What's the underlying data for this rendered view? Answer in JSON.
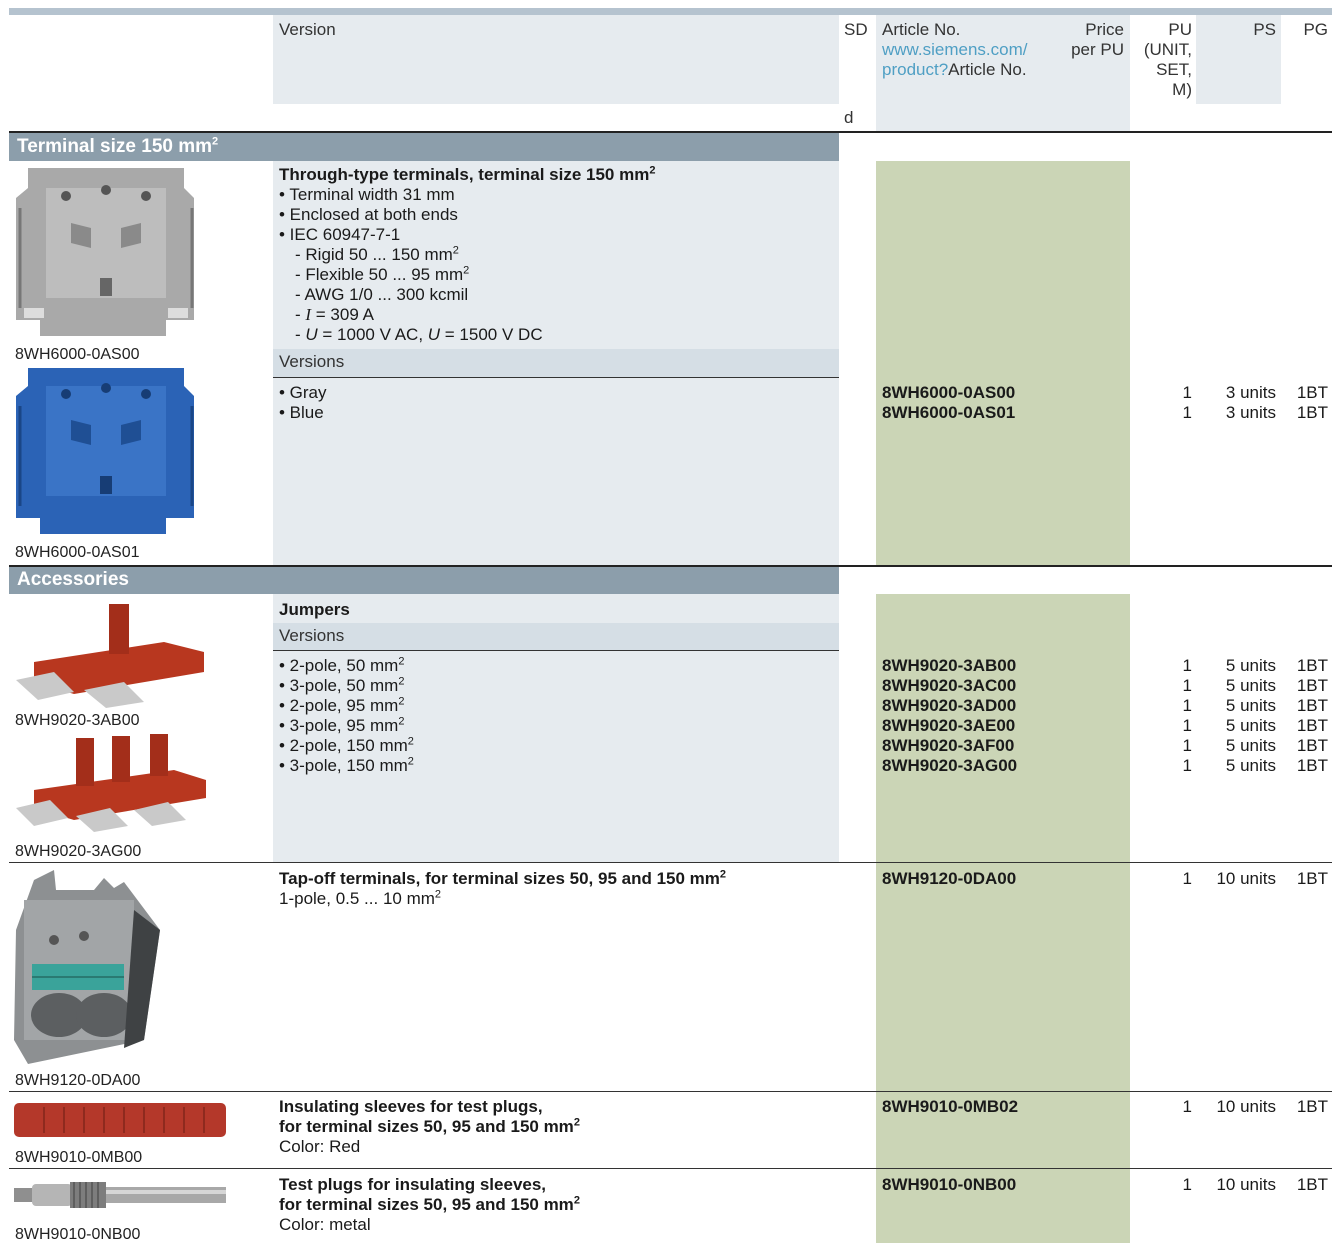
{
  "header": {
    "version": "Version",
    "sd": "SD",
    "sd_d": "d",
    "article_no": "Article No.",
    "article_link_1": "www.siemens.com/",
    "article_link_2": "product?",
    "article_link_3": "Article No.",
    "price_1": "Price",
    "price_2": "per PU",
    "pu_1": "PU",
    "pu_2": "(UNIT,",
    "pu_3": "SET,",
    "pu_4": "M)",
    "ps": "PS",
    "pg": "PG"
  },
  "section1": {
    "title": "Terminal size 150 mm",
    "title_sup": "2",
    "product": {
      "title": "Through-type terminals, terminal size 150 mm",
      "title_sup": "2",
      "bullets": [
        "• Terminal width 31 mm",
        "• Enclosed at both ends",
        "• IEC 60947-7-1"
      ],
      "sub_1": "- Rigid 50 ... 150 mm",
      "sub_2": "- Flexible 50 ... 95 mm",
      "sub_3": "- AWG 1/0 ... 300 kcmil",
      "sub_4_pre": "- ",
      "sub_4_i": "I",
      "sub_4_post": " = 309 A",
      "sub_5_pre": "- ",
      "sub_5_u1": "U",
      "sub_5_mid": " = 1000 V AC, ",
      "sub_5_u2": "U",
      "sub_5_post": " = 1500 V DC",
      "sup2": "2",
      "versions_label": "Versions",
      "rows": [
        {
          "version": "• Gray",
          "article": "8WH6000-0AS00",
          "pu": "1",
          "ps": "3 units",
          "pg": "1BT"
        },
        {
          "version": "• Blue",
          "article": "8WH6000-0AS01",
          "pu": "1",
          "ps": "3 units",
          "pg": "1BT"
        }
      ],
      "captions": [
        "8WH6000-0AS00",
        "8WH6000-0AS01"
      ]
    }
  },
  "section2": {
    "title": "Accessories",
    "jumpers": {
      "title": "Jumpers",
      "versions_label": "Versions",
      "rows": [
        {
          "version": "• 2-pole, 50 mm",
          "sup": "2",
          "article": "8WH9020-3AB00",
          "pu": "1",
          "ps": "5 units",
          "pg": "1BT"
        },
        {
          "version": "• 3-pole, 50 mm",
          "sup": "2",
          "article": "8WH9020-3AC00",
          "pu": "1",
          "ps": "5 units",
          "pg": "1BT"
        },
        {
          "version": "• 2-pole, 95 mm",
          "sup": "2",
          "article": "8WH9020-3AD00",
          "pu": "1",
          "ps": "5 units",
          "pg": "1BT"
        },
        {
          "version": "• 3-pole, 95 mm",
          "sup": "2",
          "article": "8WH9020-3AE00",
          "pu": "1",
          "ps": "5 units",
          "pg": "1BT"
        },
        {
          "version": "• 2-pole, 150 mm",
          "sup": "2",
          "article": "8WH9020-3AF00",
          "pu": "1",
          "ps": "5 units",
          "pg": "1BT"
        },
        {
          "version": "• 3-pole, 150 mm",
          "sup": "2",
          "article": "8WH9020-3AG00",
          "pu": "1",
          "ps": "5 units",
          "pg": "1BT"
        }
      ],
      "captions": [
        "8WH9020-3AB00",
        "8WH9020-3AG00"
      ]
    },
    "tapoff": {
      "title": "Tap-off terminals, for terminal sizes 50, 95 and 150 mm",
      "title_sup": "2",
      "line": "1-pole, 0.5 ... 10 mm",
      "line_sup": "2",
      "article": "8WH9120-0DA00",
      "pu": "1",
      "ps": "10 units",
      "pg": "1BT",
      "caption": "8WH9120-0DA00"
    },
    "sleeves": {
      "title_1": "Insulating sleeves for test plugs,",
      "title_2": "for terminal sizes 50, 95 and 150 mm",
      "title_sup": "2",
      "line": "Color: Red",
      "article": "8WH9010-0MB02",
      "pu": "1",
      "ps": "10 units",
      "pg": "1BT",
      "caption": "8WH9010-0MB00"
    },
    "plugs": {
      "title_1": "Test plugs for insulating sleeves,",
      "title_2": "for terminal sizes 50, 95 and 150 mm",
      "title_sup": "2",
      "line": "Color: metal",
      "article": "8WH9010-0NB00",
      "pu": "1",
      "ps": "10 units",
      "pg": "1BT",
      "caption": "8WH9010-0NB00"
    }
  }
}
